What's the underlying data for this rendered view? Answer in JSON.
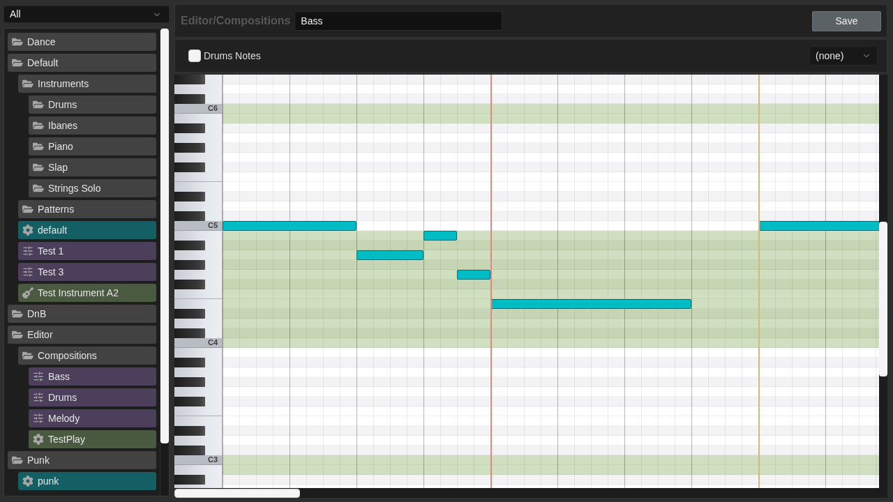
{
  "sidebar": {
    "filter": {
      "value": "All"
    },
    "tree": [
      {
        "label": "Dance",
        "kind": "folder",
        "color": "#424242"
      },
      {
        "label": "Default",
        "kind": "folder",
        "color": "#424242",
        "children": [
          {
            "label": "Instruments",
            "kind": "folder",
            "color": "#424242",
            "children": [
              {
                "label": "Drums",
                "kind": "folder",
                "color": "#424242"
              },
              {
                "label": "Ibanes",
                "kind": "folder",
                "color": "#424242"
              },
              {
                "label": "Piano",
                "kind": "folder",
                "color": "#424242"
              },
              {
                "label": "Slap",
                "kind": "folder",
                "color": "#424242"
              },
              {
                "label": "Strings Solo",
                "kind": "folder",
                "color": "#424242"
              }
            ]
          },
          {
            "label": "Patterns",
            "kind": "folder",
            "color": "#424242"
          },
          {
            "label": "default",
            "kind": "gear",
            "color": "#145f63"
          },
          {
            "label": "Test 1",
            "kind": "sliders",
            "color": "#4b3f5b"
          },
          {
            "label": "Test 3",
            "kind": "sliders",
            "color": "#4b3f5b"
          },
          {
            "label": "Test Instrument A2",
            "kind": "guitar",
            "color": "#4a5a40"
          }
        ]
      },
      {
        "label": "DnB",
        "kind": "folder",
        "color": "#424242"
      },
      {
        "label": "Editor",
        "kind": "folder",
        "color": "#424242",
        "children": [
          {
            "label": "Compositions",
            "kind": "folder",
            "color": "#424242",
            "children": [
              {
                "label": "Bass",
                "kind": "sliders",
                "color": "#4b3f5b"
              },
              {
                "label": "Drums",
                "kind": "sliders",
                "color": "#4b3f5b"
              },
              {
                "label": "Melody",
                "kind": "sliders",
                "color": "#4b3f5b"
              },
              {
                "label": "TestPlay",
                "kind": "gear",
                "color": "#4a5a40"
              }
            ]
          }
        ]
      },
      {
        "label": "Punk",
        "kind": "folder",
        "color": "#424242",
        "children": [
          {
            "label": "punk",
            "kind": "gear",
            "color": "#145f63"
          }
        ]
      }
    ]
  },
  "header": {
    "path": "Editor/Compositions",
    "name_field": {
      "value": "Bass"
    },
    "save_button": "Save"
  },
  "toolbar": {
    "drums_notes": {
      "label": "Drums Notes",
      "checked": false
    },
    "select": {
      "value": "(none)"
    }
  },
  "piano_roll": {
    "rows": [
      {
        "kind": "sharp",
        "highlighted": false
      },
      {
        "kind": "natural",
        "highlighted": false
      },
      {
        "kind": "sharp",
        "highlighted": false
      },
      {
        "kind": "natural",
        "label": "C6",
        "highlighted": true
      },
      {
        "kind": "natural",
        "highlighted": true
      },
      {
        "kind": "sharp",
        "highlighted": false
      },
      {
        "kind": "natural",
        "highlighted": false
      },
      {
        "kind": "sharp",
        "highlighted": false
      },
      {
        "kind": "natural",
        "highlighted": false
      },
      {
        "kind": "sharp",
        "highlighted": false
      },
      {
        "kind": "natural",
        "highlighted": false
      },
      {
        "kind": "natural",
        "highlighted": false
      },
      {
        "kind": "sharp",
        "highlighted": false
      },
      {
        "kind": "natural",
        "highlighted": false
      },
      {
        "kind": "sharp",
        "highlighted": false
      },
      {
        "kind": "natural",
        "label": "C5",
        "highlighted": false
      },
      {
        "kind": "natural",
        "highlighted": true
      },
      {
        "kind": "sharp",
        "highlighted": true
      },
      {
        "kind": "natural",
        "highlighted": true
      },
      {
        "kind": "sharp",
        "highlighted": true
      },
      {
        "kind": "natural",
        "highlighted": true
      },
      {
        "kind": "sharp",
        "highlighted": true
      },
      {
        "kind": "natural",
        "highlighted": true
      },
      {
        "kind": "natural",
        "highlighted": true
      },
      {
        "kind": "sharp",
        "highlighted": true
      },
      {
        "kind": "natural",
        "highlighted": true
      },
      {
        "kind": "sharp",
        "highlighted": true
      },
      {
        "kind": "natural",
        "label": "C4",
        "highlighted": true
      },
      {
        "kind": "natural",
        "highlighted": false
      },
      {
        "kind": "sharp",
        "highlighted": false
      },
      {
        "kind": "natural",
        "highlighted": false
      },
      {
        "kind": "sharp",
        "highlighted": false
      },
      {
        "kind": "natural",
        "highlighted": false
      },
      {
        "kind": "sharp",
        "highlighted": false
      },
      {
        "kind": "natural",
        "highlighted": false
      },
      {
        "kind": "natural",
        "highlighted": false
      },
      {
        "kind": "sharp",
        "highlighted": false
      },
      {
        "kind": "natural",
        "highlighted": false
      },
      {
        "kind": "sharp",
        "highlighted": false
      },
      {
        "kind": "natural",
        "label": "C3",
        "highlighted": true
      },
      {
        "kind": "natural",
        "highlighted": true
      },
      {
        "kind": "sharp",
        "highlighted": false
      }
    ],
    "markers": [
      {
        "color": "#e8857c"
      },
      {
        "color": "#d6b878"
      }
    ]
  }
}
